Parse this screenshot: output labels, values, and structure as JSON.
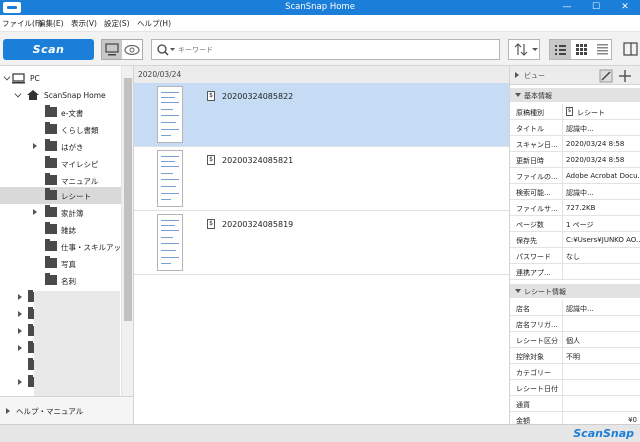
{
  "window": {
    "title": "ScanSnap Home",
    "minimize": "—",
    "maximize": "☐",
    "close": "✕"
  },
  "menu": [
    "ファイル(F)",
    "編集(E)",
    "表示(V)",
    "設定(S)",
    "ヘルプ(H)"
  ],
  "toolbar": {
    "scan_label": "Scan",
    "search_placeholder": "キーワード"
  },
  "tree": {
    "pc": "PC",
    "home": "ScanSnap Home",
    "folders": [
      "e-文書",
      "くらし書類",
      "はがき",
      "マイレシピ",
      "マニュアル",
      "レシート",
      "家計簿",
      "雑誌",
      "仕事・スキルアップ",
      "写真",
      "名刺"
    ],
    "selected": "レシート"
  },
  "help": "ヘルプ・マニュアル",
  "list": {
    "date": "2020/03/24",
    "files": [
      "20200324085822",
      "20200324085821",
      "20200324085819"
    ],
    "selected_index": 0
  },
  "panel": {
    "view_label": "ビュー",
    "basic_header": "基本情報",
    "basic": [
      {
        "k": "原稿種別",
        "v": "レシート"
      },
      {
        "k": "タイトル",
        "v": "認識中..."
      },
      {
        "k": "スキャン日...",
        "v": "2020/03/24 8:58"
      },
      {
        "k": "更新日時",
        "v": "2020/03/24 8:58"
      },
      {
        "k": "ファイルの...",
        "v": "Adobe Acrobat Docu..."
      },
      {
        "k": "検索可能...",
        "v": "認識中..."
      },
      {
        "k": "ファイルサ...",
        "v": "727.2KB"
      },
      {
        "k": "ページ数",
        "v": "1 ページ"
      },
      {
        "k": "保存先",
        "v": "C:¥Users¥JUNKO AO..."
      },
      {
        "k": "パスワード",
        "v": "なし"
      },
      {
        "k": "連携アプ...",
        "v": ""
      }
    ],
    "receipt_header": "レシート情報",
    "receipt": [
      {
        "k": "店名",
        "v": "認識中..."
      },
      {
        "k": "店名フリガ...",
        "v": ""
      },
      {
        "k": "レシート区分",
        "v": "個人"
      },
      {
        "k": "控除対象",
        "v": "不明"
      },
      {
        "k": "カテゴリー",
        "v": ""
      },
      {
        "k": "レシート日付",
        "v": ""
      },
      {
        "k": "通貨",
        "v": ""
      },
      {
        "k": "金額",
        "v": "¥0"
      }
    ]
  },
  "status": {
    "brand": "ScanSnap"
  },
  "colors": {
    "accent": "#1b7fd9",
    "selection": "#c5dcf4"
  }
}
